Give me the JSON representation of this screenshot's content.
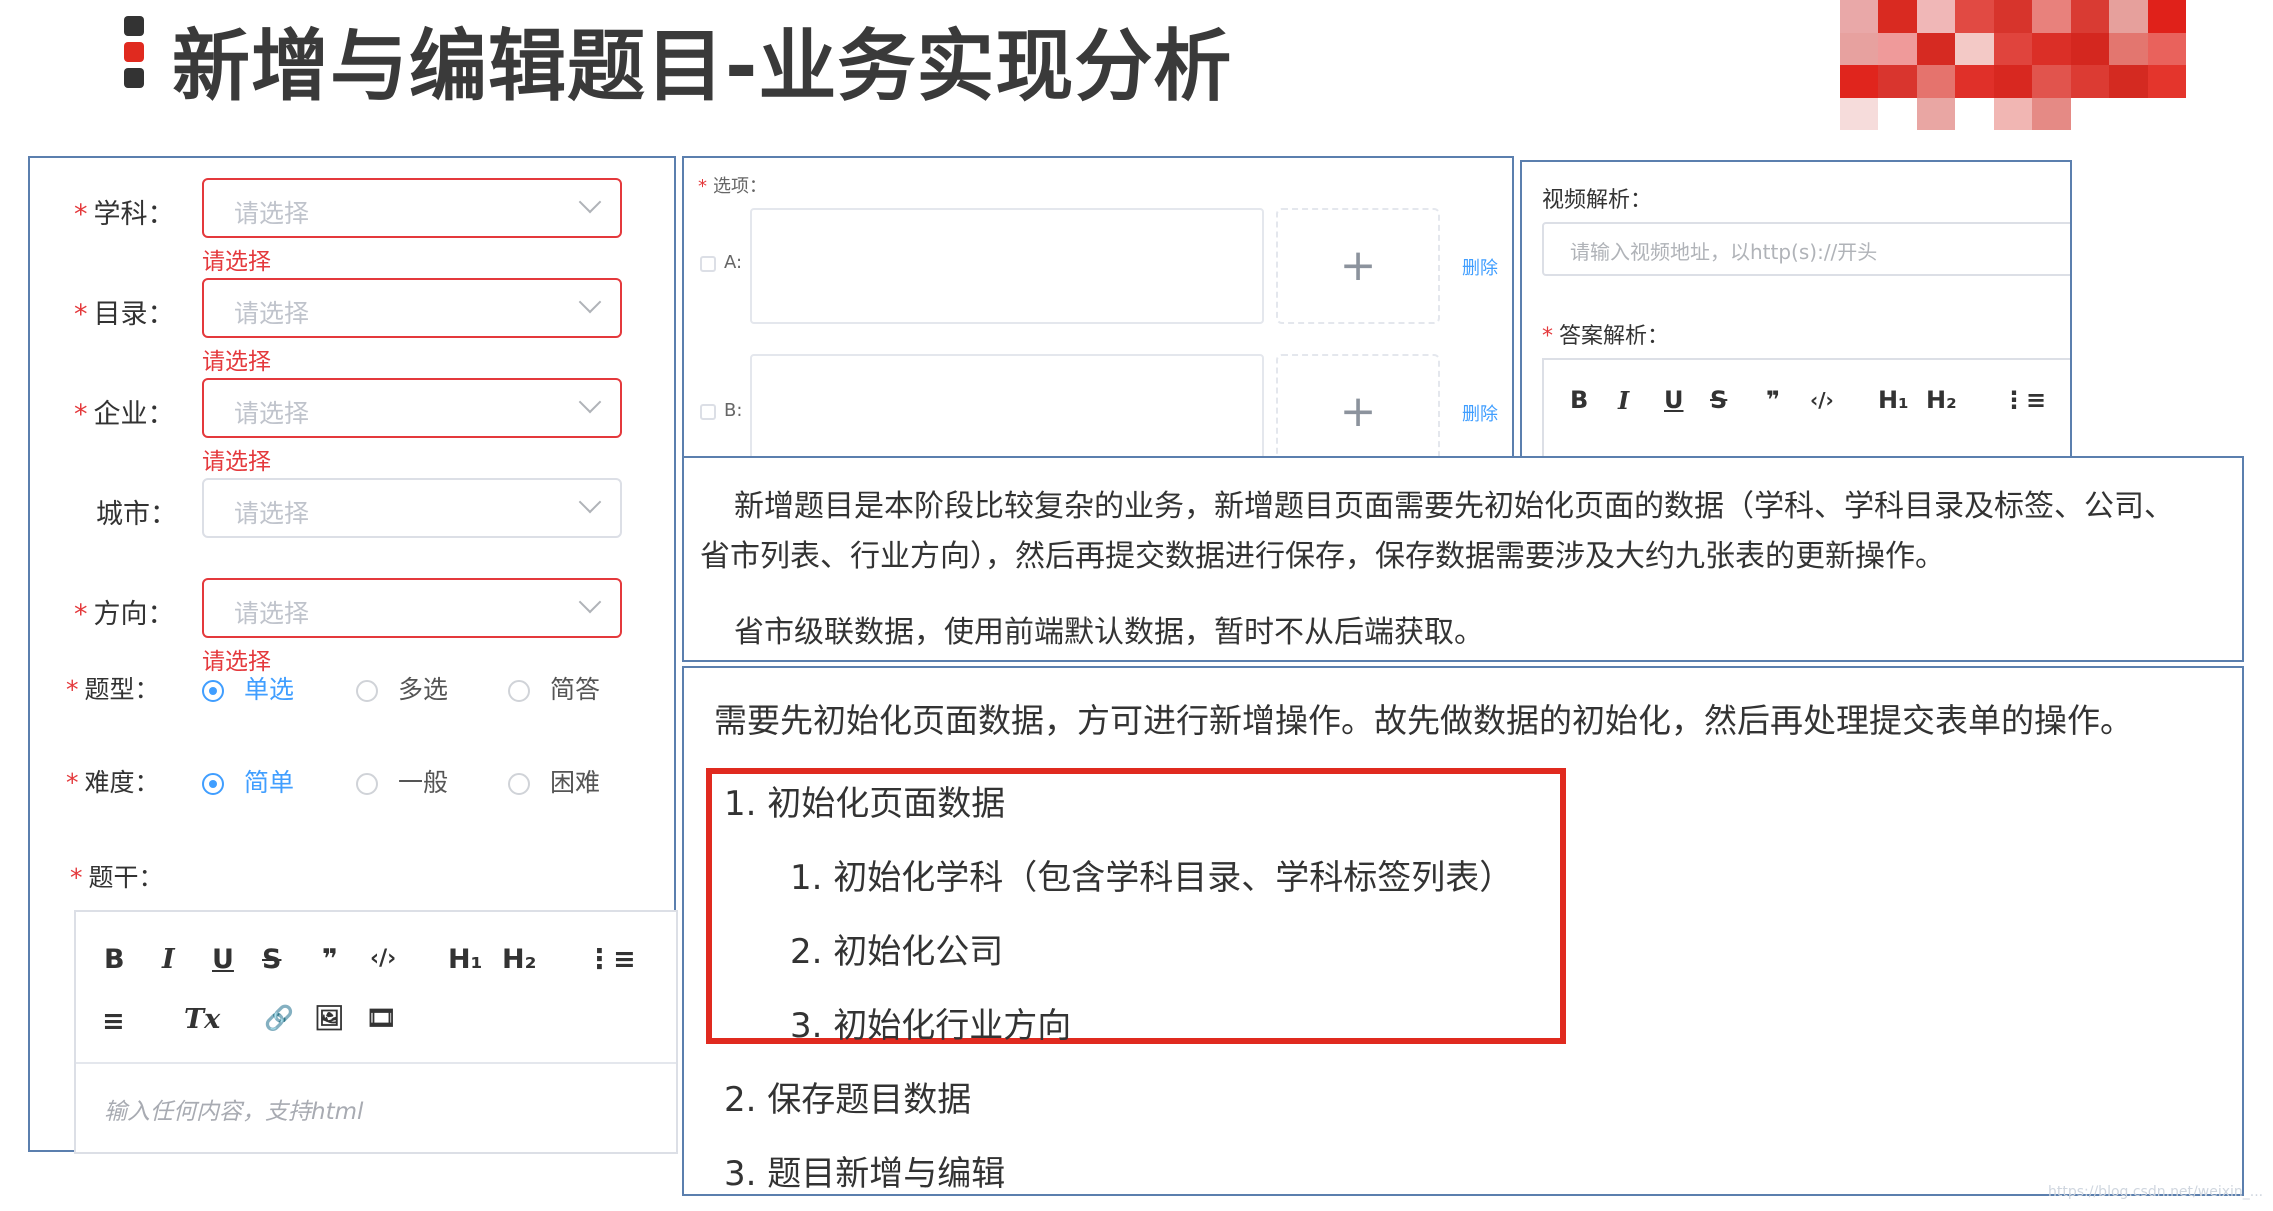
{
  "title": "新增与编辑题目-业务实现分析",
  "mosaic_colors": [
    "#e9a8a8",
    "#d92a21",
    "#f0b7b7",
    "#e14a43",
    "#d7342c",
    "#e8817c",
    "#d93b33",
    "#e6a09c",
    "#e0211a",
    "#e7a19f",
    "#ef9a9a",
    "#d62a22",
    "#f3c9c6",
    "#e0443d",
    "#db2f27",
    "#d4271f",
    "#e3766f",
    "#e9625c",
    "#e0251d",
    "#d9352e",
    "#e5736d",
    "#e03029",
    "#d82820",
    "#e1544d",
    "#dc3b33",
    "#d42a21",
    "#e4352c",
    "#f6dcdb",
    "#ffffff",
    "#e9a6a3",
    "#ffffff",
    "#f1b6b3",
    "#e58a85",
    "#ffffff",
    "#ffffff",
    "#ffffff"
  ],
  "form": {
    "fields": [
      {
        "label": "学科：",
        "required": true,
        "placeholder": "请选择",
        "error": "请选择",
        "invalid": true
      },
      {
        "label": "目录：",
        "required": true,
        "placeholder": "请选择",
        "error": "请选择",
        "invalid": true
      },
      {
        "label": "企业：",
        "required": true,
        "placeholder": "请选择",
        "error": "请选择",
        "invalid": true
      },
      {
        "label": "城市：",
        "required": false,
        "placeholder": "请选择",
        "error": "",
        "invalid": false
      },
      {
        "label": "方向：",
        "required": true,
        "placeholder": "请选择",
        "error": "请选择",
        "invalid": true
      }
    ],
    "type_label": "题型：",
    "type_options": [
      "单选",
      "多选",
      "简答"
    ],
    "difficulty_label": "难度：",
    "difficulty_options": [
      "简单",
      "一般",
      "困难"
    ],
    "stem_label": "题干：",
    "toolbar": {
      "bold": "B",
      "italic": "I",
      "underline": "U",
      "strike": "S",
      "quote": "❞",
      "code": "‹/›",
      "h1": "H₁",
      "h2": "H₂",
      "ol": "⋮≡",
      "align": "≡",
      "clear": "Tx",
      "link": "🔗",
      "image": "🖼",
      "video": "🎞"
    },
    "stem_placeholder": "输入任何内容，支持html"
  },
  "options": {
    "label": "选项：",
    "items": [
      {
        "key": "A:",
        "plus": "+",
        "delete": "删除"
      },
      {
        "key": "B:",
        "plus": "+",
        "delete": "删除"
      }
    ]
  },
  "right": {
    "video_label": "视频解析：",
    "video_placeholder": "请输入视频地址，以http(s)://开头",
    "answer_label": "答案解析："
  },
  "desc": {
    "p1_line1": "新增题目是本阶段比较复杂的业务，新增题目页面需要先初始化页面的数据（学科、学科目录及标签、公司、",
    "p1_line2": "省市列表、行业方向），然后再提交数据进行保存，保存数据需要涉及大约九张表的更新操作。",
    "p2": "省市级联数据，使用前端默认数据，暂时不从后端获取。"
  },
  "steps": {
    "intro": "需要先初始化页面数据，方可进行新增操作。故先做数据的初始化，然后再处理提交表单的操作。",
    "s1": "1. 初始化页面数据",
    "s1_1": "1. 初始化学科（包含学科目录、学科标签列表）",
    "s1_2": "2. 初始化公司",
    "s1_3": "3. 初始化行业方向",
    "s2": "2. 保存题目数据",
    "s3": "3. 题目新增与编辑"
  },
  "watermark": "https://blog.csdn.net/weixin_..."
}
